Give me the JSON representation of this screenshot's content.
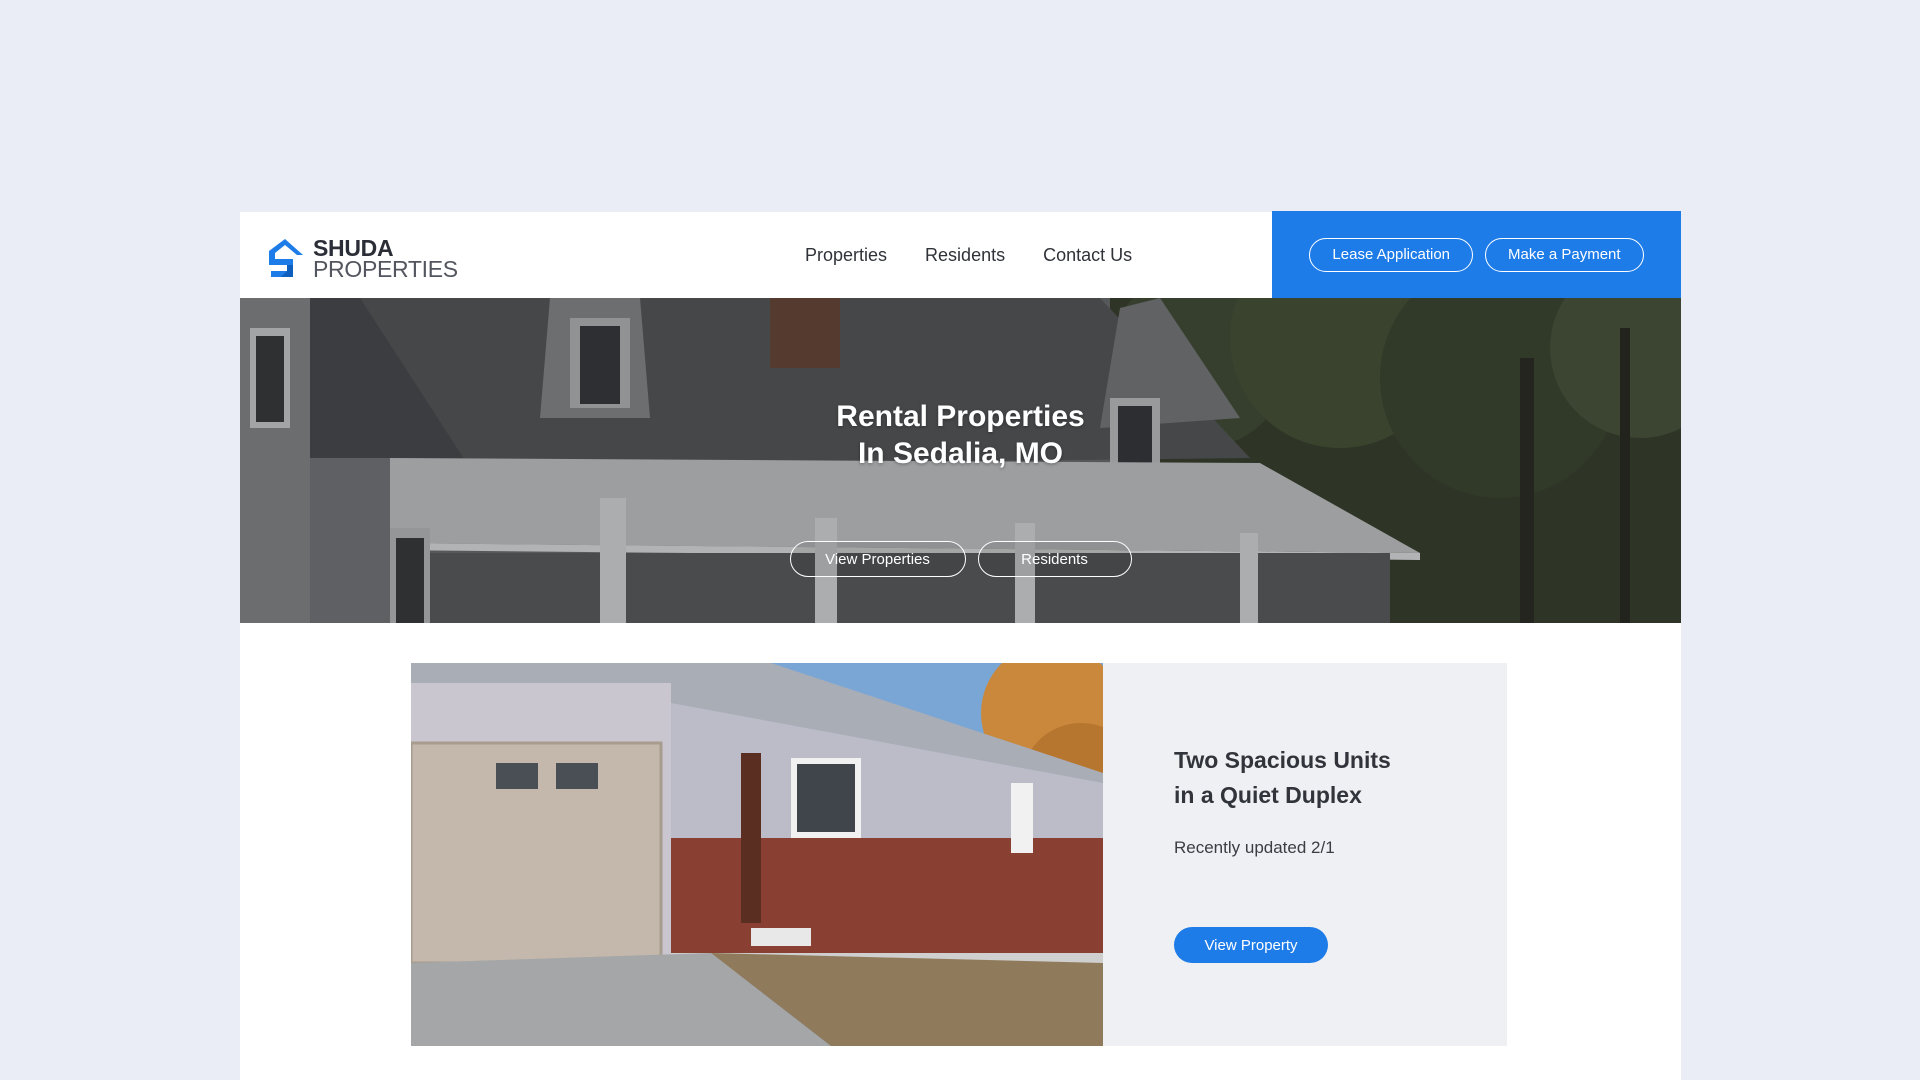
{
  "colors": {
    "accent": "#1e7ce8",
    "page_bg": "#eaedf6",
    "panel_bg": "#eef0f3"
  },
  "brand": {
    "name_line1": "SHUDA",
    "name_line2": "PROPERTIES",
    "logo_icon": "house-s-logo-icon"
  },
  "nav": {
    "items": [
      {
        "label": "Properties"
      },
      {
        "label": "Residents"
      },
      {
        "label": "Contact Us"
      }
    ]
  },
  "header_actions": {
    "lease_label": "Lease Application",
    "payment_label": "Make a Payment"
  },
  "hero": {
    "title_line1": "Rental Properties",
    "title_line2": "In Sedalia, MO",
    "primary_label": "View Properties",
    "secondary_label": "Residents"
  },
  "feature": {
    "title_line1": "Two Spacious Units",
    "title_line2": "in a Quiet Duplex",
    "subtitle": "Recently updated 2/1",
    "button_label": "View Property"
  }
}
